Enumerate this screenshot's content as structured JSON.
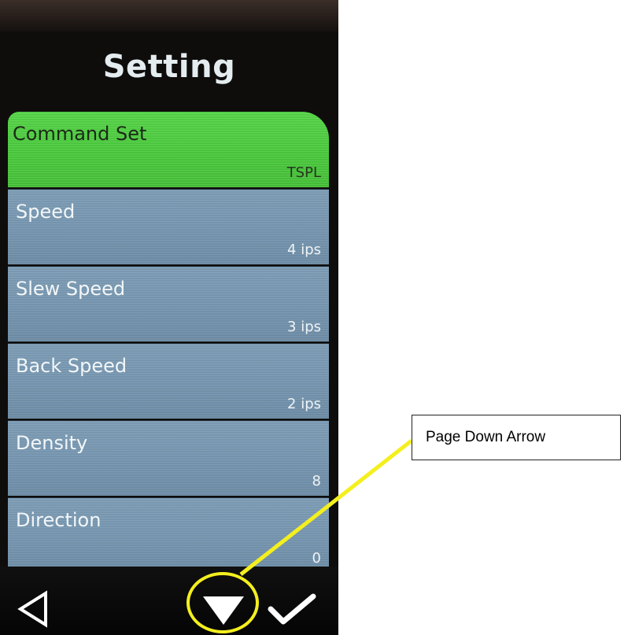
{
  "screen": {
    "title": "Setting",
    "items": [
      {
        "label": "Command Set",
        "value": "TSPL",
        "selected": true
      },
      {
        "label": "Speed",
        "value": "4 ips",
        "selected": false
      },
      {
        "label": "Slew Speed",
        "value": "3 ips",
        "selected": false
      },
      {
        "label": "Back Speed",
        "value": "2 ips",
        "selected": false
      },
      {
        "label": "Density",
        "value": "8",
        "selected": false
      },
      {
        "label": "Direction",
        "value": "0",
        "selected": false
      }
    ],
    "nav": {
      "back_icon": "triangle-left-outline-icon",
      "down_icon": "triangle-down-filled-icon",
      "ok_icon": "checkmark-icon"
    },
    "colors": {
      "selected_item": "#4ccc3e",
      "item": "#7898b2",
      "highlight": "#f4ef1e"
    }
  },
  "callout": {
    "text": "Page Down Arrow"
  }
}
